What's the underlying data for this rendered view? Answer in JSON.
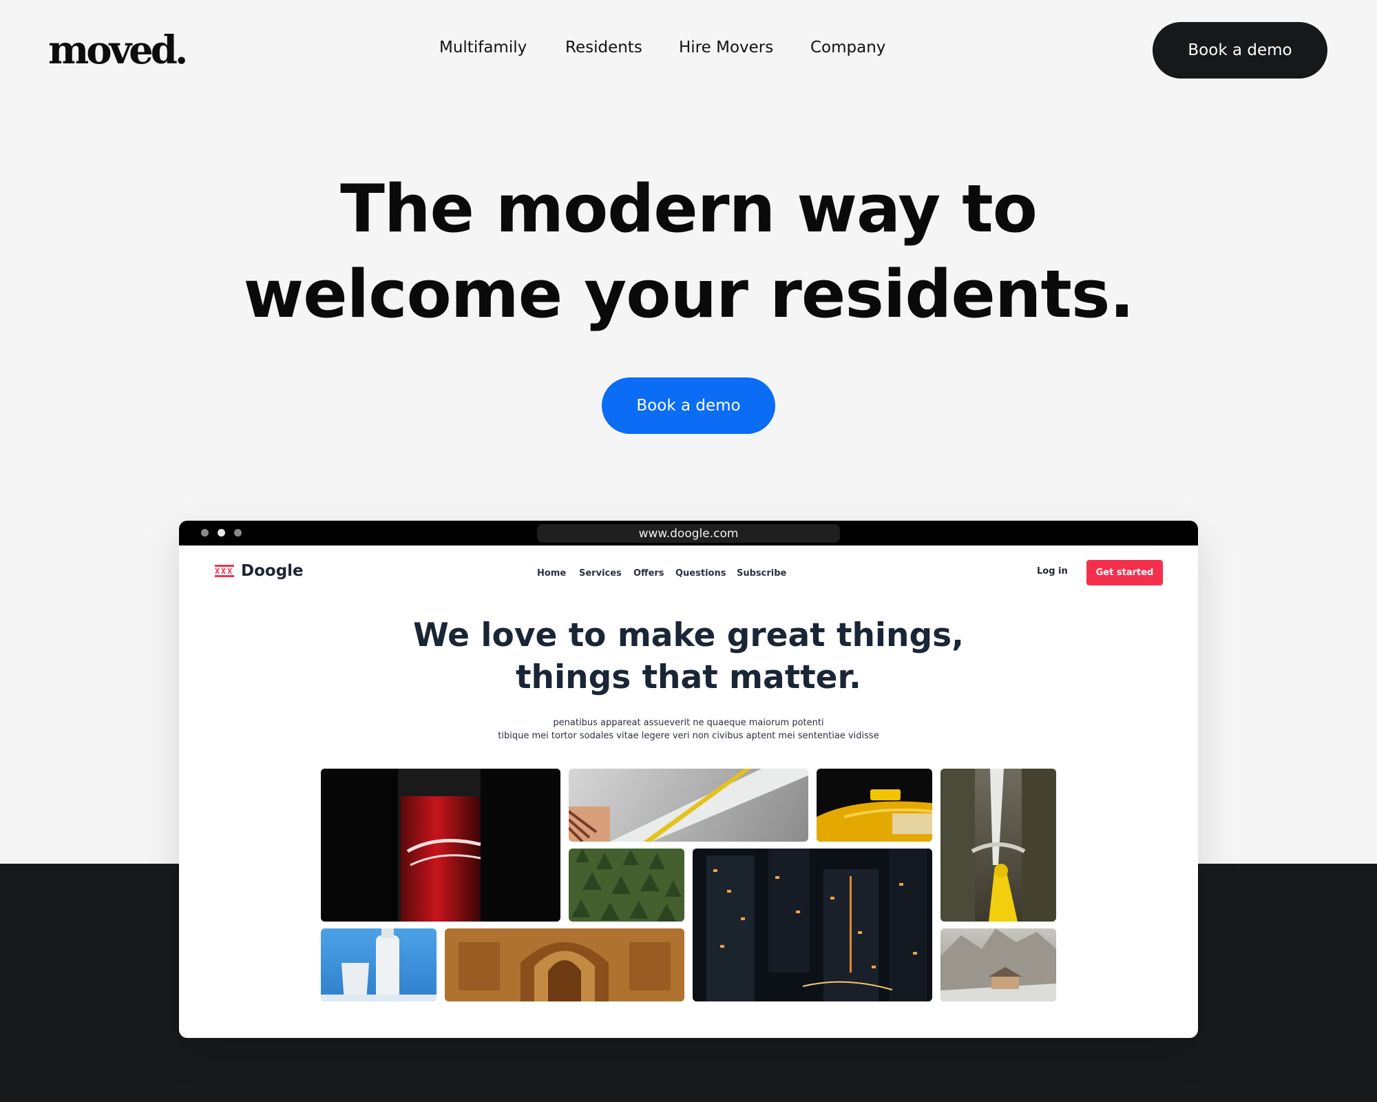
{
  "header": {
    "logo": "moved.",
    "nav": [
      "Multifamily",
      "Residents",
      "Hire Movers",
      "Company"
    ],
    "cta": "Book a demo"
  },
  "hero": {
    "title_line1": "The modern way to",
    "title_line2": "welcome your residents.",
    "cta": "Book a demo"
  },
  "browser": {
    "url": "www.doogle.com",
    "site": {
      "logo": "Doogle",
      "nav": [
        "Home",
        "Services",
        "Offers",
        "Questions",
        "Subscribe"
      ],
      "login": "Log in",
      "cta": "Get started",
      "title_line1": "We love to make great things,",
      "title_line2": "things that matter.",
      "subtitle_line1": "penatibus appareat assueverit ne quaeque maiorum potenti",
      "subtitle_line2": "tibique mei tortor sodales vitae legere veri non civibus aptent mei sententiae vidisse"
    }
  },
  "colors": {
    "page_bg": "#f5f5f5",
    "dark": "#18191b",
    "primary_blue": "#0b6cf5",
    "doogle_red": "#f4304c",
    "doogle_navy": "#1a2536"
  }
}
